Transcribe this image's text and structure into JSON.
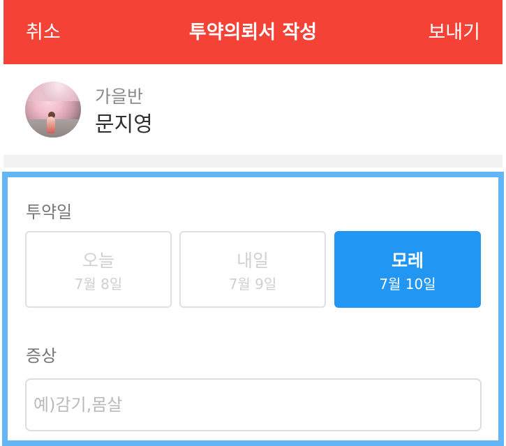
{
  "header": {
    "cancel_label": "취소",
    "title": "투약의뢰서 작성",
    "send_label": "보내기"
  },
  "profile": {
    "class_name": "가을반",
    "child_name": "문지영"
  },
  "medication": {
    "label": "투약일",
    "options": [
      {
        "day": "오늘",
        "date": "7월 8일",
        "selected": false
      },
      {
        "day": "내일",
        "date": "7월 9일",
        "selected": false
      },
      {
        "day": "모레",
        "date": "7월 10일",
        "selected": true
      }
    ]
  },
  "symptom": {
    "label": "증상",
    "placeholder": "예)감기,몸살",
    "value": ""
  },
  "colors": {
    "header": "#f44336",
    "selected": "#2196f3",
    "highlight_border": "#64b5f6"
  },
  "icons": {
    "avatar": "child-photo"
  }
}
